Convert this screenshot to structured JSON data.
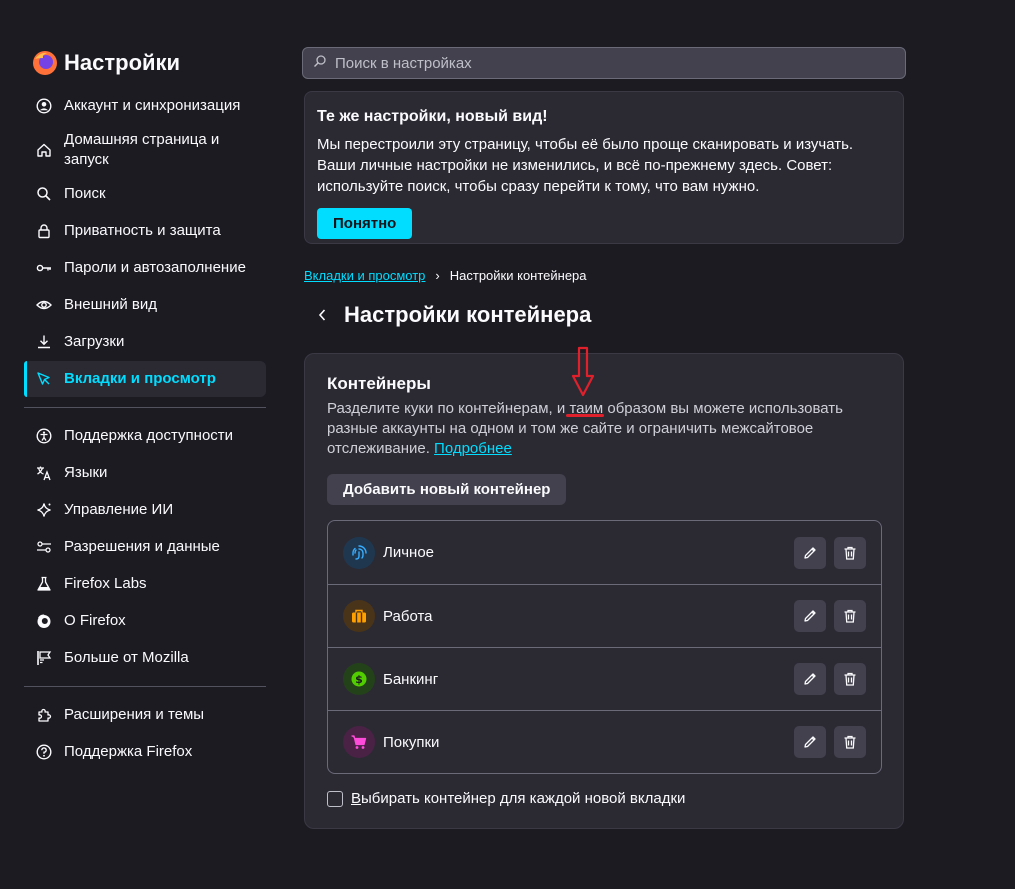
{
  "app": {
    "title": "Настройки"
  },
  "sidebar": {
    "items": [
      {
        "label": "Аккаунт и синхронизация",
        "icon": "account-icon"
      },
      {
        "label": "Домашняя страница и запуск",
        "icon": "home-icon"
      },
      {
        "label": "Поиск",
        "icon": "search-icon"
      },
      {
        "label": "Приватность и защита",
        "icon": "lock-icon"
      },
      {
        "label": "Пароли и автозаполнение",
        "icon": "key-icon"
      },
      {
        "label": "Внешний вид",
        "icon": "eye-icon"
      },
      {
        "label": "Загрузки",
        "icon": "download-icon"
      },
      {
        "label": "Вкладки и просмотр",
        "icon": "cursor-icon",
        "active": true
      }
    ],
    "items2": [
      {
        "label": "Поддержка доступности",
        "icon": "accessibility-icon"
      },
      {
        "label": "Языки",
        "icon": "translate-icon"
      },
      {
        "label": "Управление ИИ",
        "icon": "sparkle-icon"
      },
      {
        "label": "Разрешения и данные",
        "icon": "permissions-icon"
      },
      {
        "label": "Firefox Labs",
        "icon": "flask-icon"
      },
      {
        "label": "О Firefox",
        "icon": "firefox-icon"
      },
      {
        "label": "Больше от Mozilla",
        "icon": "mozilla-flag-icon"
      }
    ],
    "items3": [
      {
        "label": "Расширения и темы",
        "icon": "puzzle-icon"
      },
      {
        "label": "Поддержка Firefox",
        "icon": "help-icon"
      }
    ]
  },
  "search": {
    "placeholder": "Поиск в настройках"
  },
  "notice": {
    "title": "Те же настройки, новый вид!",
    "text": "Мы перестроили эту страницу, чтобы её было проще сканировать и изучать. Ваши личные настройки не изменились, и всё по-прежнему здесь. Совет: используйте поиск, чтобы сразу перейти к тому, что вам нужно.",
    "button": "Понятно"
  },
  "breadcrumb": {
    "parent": "Вкладки и просмотр",
    "current": "Настройки контейнера"
  },
  "page": {
    "title": "Настройки контейнера"
  },
  "containers": {
    "title": "Контейнеры",
    "desc_before": "Разделите куки по контейнерам, и ",
    "desc_highlight": "таим",
    "desc_after": " образом вы можете использовать разные аккаунты на одном и том же сайте и ограничить межсайтовое отслеживание. ",
    "learn_more": "Подробнее",
    "add_button": "Добавить новый контейнер",
    "list": [
      {
        "name": "Личное",
        "icon": "fingerprint-icon",
        "color": "#37adff"
      },
      {
        "name": "Работа",
        "icon": "briefcase-icon",
        "color": "#ff9f00"
      },
      {
        "name": "Банкинг",
        "icon": "dollar-icon",
        "color": "#51cd00"
      },
      {
        "name": "Покупки",
        "icon": "cart-icon",
        "color": "#ff4bda"
      }
    ],
    "checkbox_first": "В",
    "checkbox_rest": "ыбирать контейнер для каждой новой вкладки"
  },
  "colors": {
    "accent": "#00ddff",
    "background": "#1c1b22",
    "card": "#2b2a33",
    "annotation": "#e0202b"
  }
}
